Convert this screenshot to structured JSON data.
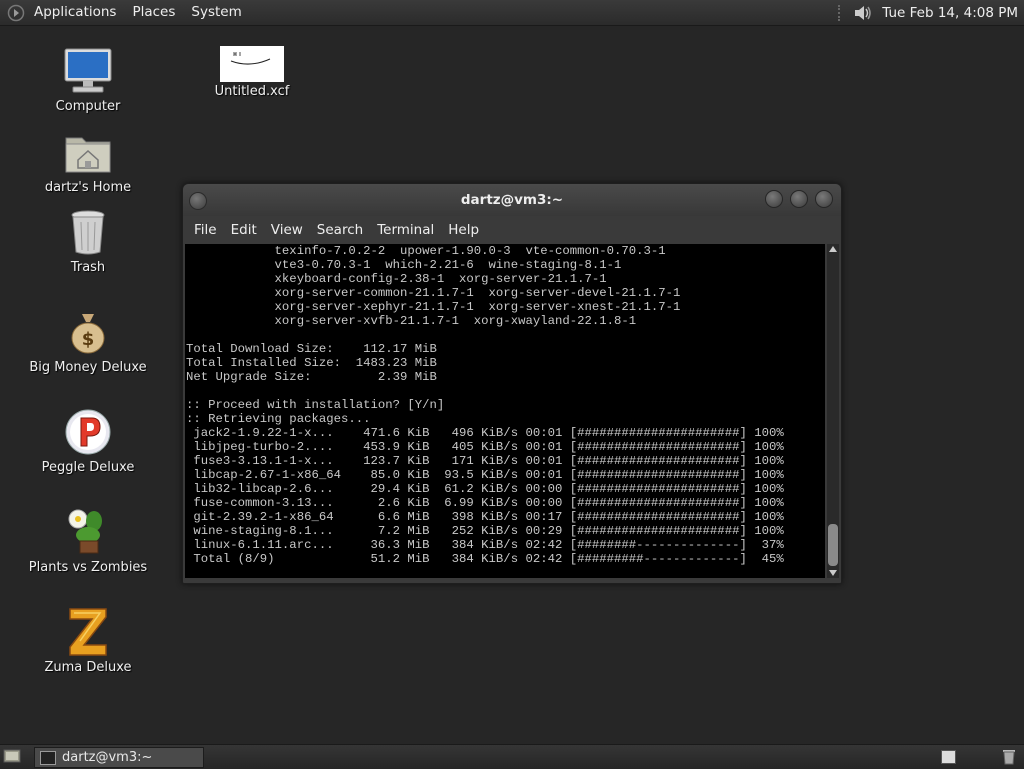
{
  "top_panel": {
    "menus": [
      "Applications",
      "Places",
      "System"
    ],
    "clock": "Tue Feb 14,  4:08 PM"
  },
  "desktop_icons": [
    {
      "label": "Computer",
      "icon": "computer-icon"
    },
    {
      "label": "dartz's Home",
      "icon": "home-folder-icon"
    },
    {
      "label": "Trash",
      "icon": "trash-icon"
    },
    {
      "label": "Big Money Deluxe",
      "icon": "money-bag-icon"
    },
    {
      "label": "Peggle Deluxe",
      "icon": "peggle-icon"
    },
    {
      "label": "Plants vs Zombies",
      "icon": "plant-icon"
    },
    {
      "label": "Zuma Deluxe",
      "icon": "zuma-icon"
    },
    {
      "label": "Untitled.xcf",
      "icon": "image-file-icon"
    }
  ],
  "terminal": {
    "title": "dartz@vm3:~",
    "menu": [
      "File",
      "Edit",
      "View",
      "Search",
      "Terminal",
      "Help"
    ],
    "lines": [
      "            texinfo-7.0.2-2  upower-1.90.0-3  vte-common-0.70.3-1",
      "            vte3-0.70.3-1  which-2.21-6  wine-staging-8.1-1",
      "            xkeyboard-config-2.38-1  xorg-server-21.1.7-1",
      "            xorg-server-common-21.1.7-1  xorg-server-devel-21.1.7-1",
      "            xorg-server-xephyr-21.1.7-1  xorg-server-xnest-21.1.7-1",
      "            xorg-server-xvfb-21.1.7-1  xorg-xwayland-22.1.8-1",
      "",
      "Total Download Size:    112.17 MiB",
      "Total Installed Size:  1483.23 MiB",
      "Net Upgrade Size:         2.39 MiB",
      "",
      ":: Proceed with installation? [Y/n]",
      ":: Retrieving packages...",
      " jack2-1.9.22-1-x...    471.6 KiB   496 KiB/s 00:01 [######################] 100%",
      " libjpeg-turbo-2....    453.9 KiB   405 KiB/s 00:01 [######################] 100%",
      " fuse3-3.13.1-1-x...    123.7 KiB   171 KiB/s 00:01 [######################] 100%",
      " libcap-2.67-1-x86_64    85.0 KiB  93.5 KiB/s 00:01 [######################] 100%",
      " lib32-libcap-2.6...     29.4 KiB  61.2 KiB/s 00:00 [######################] 100%",
      " fuse-common-3.13...      2.6 KiB  6.99 KiB/s 00:00 [######################] 100%",
      " git-2.39.2-1-x86_64      6.6 MiB   398 KiB/s 00:17 [######################] 100%",
      " wine-staging-8.1...      7.2 MiB   252 KiB/s 00:29 [######################] 100%",
      " linux-6.1.11.arc...     36.3 MiB   384 KiB/s 02:42 [########--------------]  37%",
      " Total (8/9)             51.2 MiB   384 KiB/s 02:42 [#########-------------]  45%"
    ]
  },
  "taskbar": {
    "task_label": "dartz@vm3:~"
  }
}
